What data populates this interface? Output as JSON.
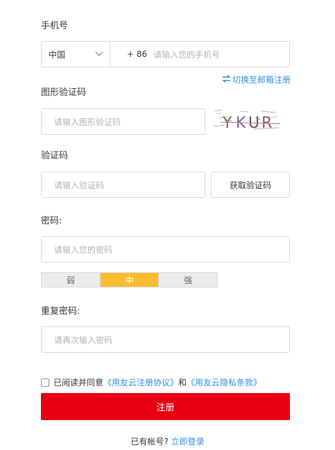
{
  "phone": {
    "label": "手机号",
    "country": "中国",
    "prefix": "+ 86",
    "placeholder": "请输入您的手机号",
    "switch_link": "切换至邮箱注册"
  },
  "captcha_image": {
    "label": "图形验证码",
    "placeholder": "请输入图形验证码",
    "captcha_text": "YKUR"
  },
  "code": {
    "label": "验证码",
    "placeholder": "请输入验证码",
    "button": "获取验证码"
  },
  "password": {
    "label": "密码:",
    "placeholder": "请输入您的密码",
    "strength": [
      "弱",
      "中",
      "强"
    ],
    "active_strength": "中"
  },
  "confirm": {
    "label": "重复密码:",
    "placeholder": "请再次输入密码"
  },
  "agreement": {
    "prefix": "已阅读并同意",
    "link1": "《用友云注册协议》",
    "and": "和",
    "link2": "《用友云隐私条款》"
  },
  "submit": {
    "label": "注册"
  },
  "login": {
    "text": "已有帐号?",
    "link": "立即登录"
  },
  "colors": {
    "accent": "#e60012",
    "link": "#2f8fe8",
    "strength_active": "#fbbd2f"
  }
}
